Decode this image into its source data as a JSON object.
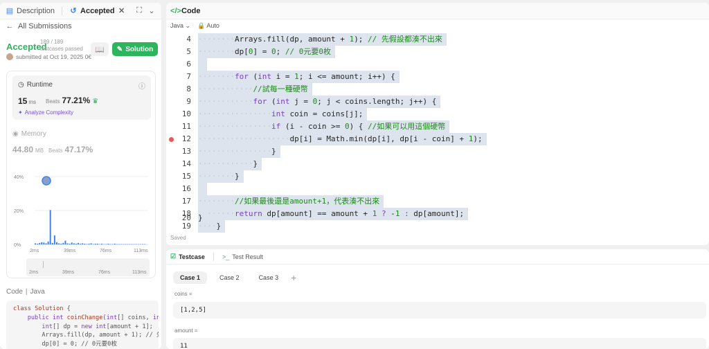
{
  "left": {
    "tabs": [
      {
        "label": "Description"
      },
      {
        "label": "Accepted"
      }
    ],
    "back_label": "All Submissions",
    "status": "Accepted",
    "passed_count": "189 / 189",
    "passed_label": "testcases passed",
    "submitted": "submitted at Oct 19, 2025 0€",
    "solution_btn": "Solution",
    "runtime": {
      "label": "Runtime",
      "value": "15",
      "unit": "ms",
      "beats_label": "Beats",
      "beats": "77.21%",
      "analyze": "Analyze Complexity"
    },
    "memory": {
      "label": "Memory",
      "value": "44.80",
      "unit": "MB",
      "beats_label": "Beats",
      "beats": "47.17%"
    },
    "chart_y_ticks": [
      "40%",
      "20%",
      "0%"
    ],
    "chart_x_ticks": [
      "2ms",
      "39ms",
      "76ms",
      "113ms"
    ],
    "brush_ticks": [
      "2ms",
      "39ms",
      "76ms",
      "113ms"
    ],
    "code_header": {
      "title": "Code",
      "lang": "Java"
    }
  },
  "editor": {
    "title": "Code",
    "language": "Java",
    "mode": "Auto",
    "saved": "Saved"
  },
  "tests": {
    "tab_testcase": "Testcase",
    "tab_result": "Test Result",
    "cases": [
      "Case 1",
      "Case 2",
      "Case 3"
    ],
    "fields": [
      {
        "label": "coins =",
        "value": "[1,2,5]"
      },
      {
        "label": "amount =",
        "value": "11"
      }
    ]
  },
  "colors": {
    "accent": "#2db55d",
    "highlight": "#dde4ee",
    "breakpoint": "#e45b5b"
  }
}
